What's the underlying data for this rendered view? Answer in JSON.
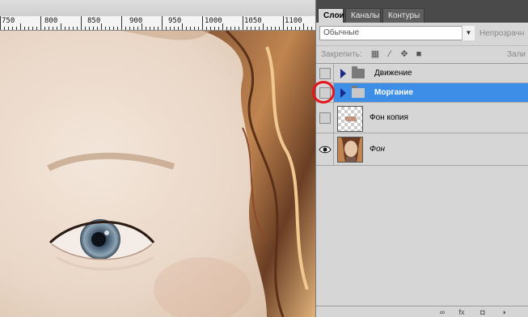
{
  "ruler": {
    "labels": [
      "750",
      "800",
      "850",
      "900",
      "950",
      "1000",
      "1050",
      "1100"
    ]
  },
  "panel": {
    "tabs": [
      {
        "label": "Слои",
        "active": true
      },
      {
        "label": "Каналы",
        "active": false
      },
      {
        "label": "Контуры",
        "active": false
      }
    ],
    "blend_mode": "Обычные",
    "opacity_label": "Непрозрачн",
    "lock_label": "Закрепить:",
    "fill_label": "Зали",
    "lock_icons": [
      "transparency-lock-icon",
      "brush-icon",
      "move-icon",
      "padlock-icon"
    ],
    "layers": [
      {
        "name": "Движение",
        "type": "group",
        "visible": false,
        "selected": false
      },
      {
        "name": "Моргание",
        "type": "group",
        "visible": false,
        "selected": true
      },
      {
        "name": "Фон копия",
        "type": "layer",
        "visible": false,
        "selected": false
      },
      {
        "name": "Фон",
        "type": "background",
        "visible": true,
        "selected": false
      }
    ],
    "bottom_icons": [
      "link-icon",
      "fx-icon",
      "mask-icon",
      "adjustment-icon"
    ]
  },
  "colors": {
    "selection": "#3d8ee6",
    "highlight_ring": "#e4161b",
    "panel_bg": "#d6d6d6"
  }
}
